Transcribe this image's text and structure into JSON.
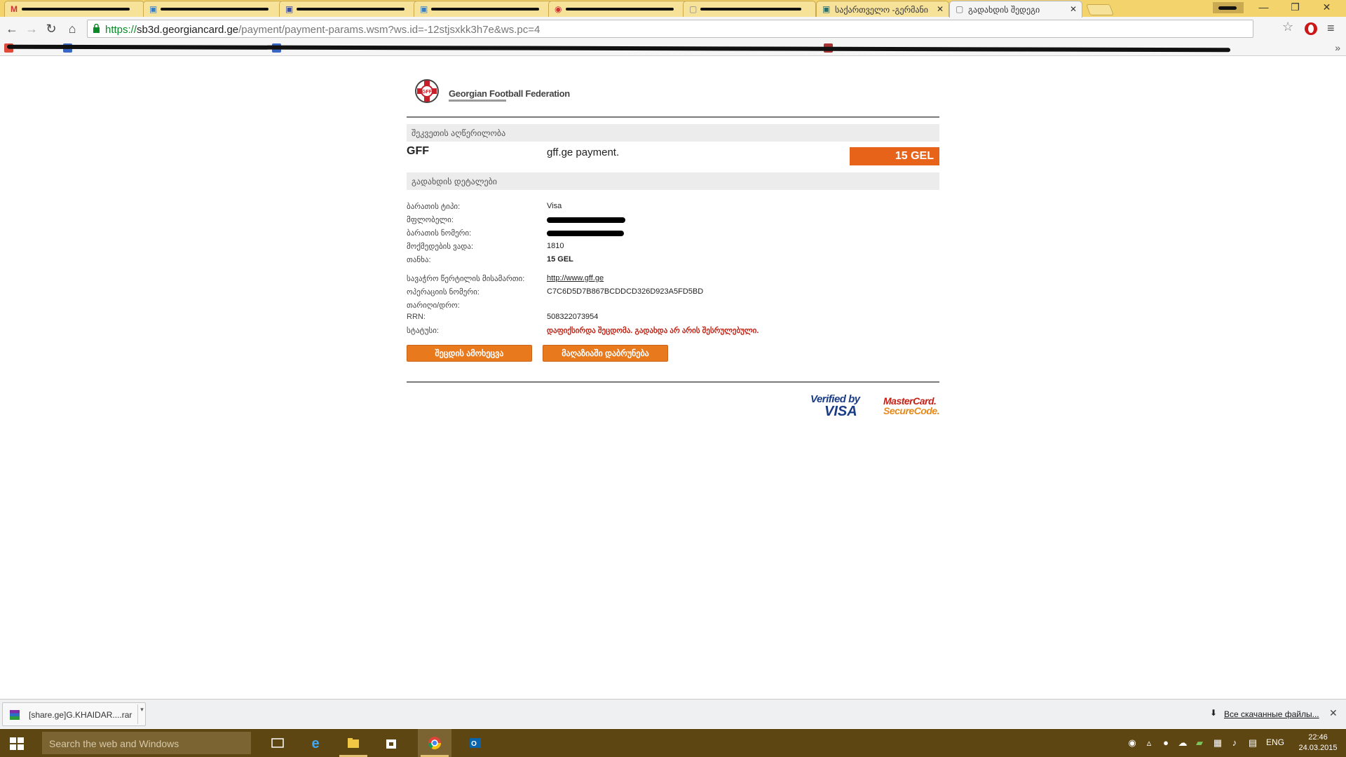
{
  "browser": {
    "tabs": [
      {
        "title": "",
        "favicon": "gmail-icon",
        "redacted": true
      },
      {
        "title": "",
        "favicon": "page-icon",
        "redacted": true
      },
      {
        "title": "",
        "favicon": "page-icon",
        "redacted": true
      },
      {
        "title": "",
        "favicon": "page-icon",
        "redacted": true
      },
      {
        "title": "",
        "favicon": "page-icon",
        "redacted": true
      },
      {
        "title": "",
        "favicon": "page-icon",
        "redacted": true
      },
      {
        "title": "საქართველო -გერმანი",
        "favicon": "page-icon",
        "redacted": false
      },
      {
        "title": "გადახდის შედეგი",
        "favicon": "page-icon",
        "redacted": false,
        "active": true
      }
    ],
    "window_controls": {
      "minimize": "—",
      "restore": "❐",
      "close": "✕"
    },
    "url_proto": "https://",
    "url_host": "sb3d.georgiancard.ge",
    "url_path": "/payment/payment-params.wsm?ws.id=-12stjsxkk3h7e&ws.pc=4"
  },
  "page": {
    "logo_text": "Georgian Football Federation",
    "section_order": "შეკვეთის აღწერილობა",
    "merchant": "GFF",
    "description": "gff.ge payment.",
    "amount_badge": "15 GEL",
    "section_details": "გადახდის დეტალები",
    "details": [
      {
        "label": "ბარათის ტიპი:",
        "value": "Visa"
      },
      {
        "label": "მფლობელი:",
        "value": "",
        "redacted": true
      },
      {
        "label": "ბარათის ნომერი:",
        "value": "",
        "redacted": true
      },
      {
        "label": "მოქმედების ვადა:",
        "value": "1810"
      },
      {
        "label": "თანხა:",
        "value": "15 GEL"
      }
    ],
    "details2": [
      {
        "label": "სავაჭრო წერტილის მისამართი:",
        "value": "http://www.gff.ge"
      },
      {
        "label": "ოპერაციის ნომერი:",
        "value": "C7C6D5D7B867BCDDCD326D923A5FD5BD"
      },
      {
        "label": "თარიღი/დრო:",
        "value": ""
      },
      {
        "label": "RRN:",
        "value": "508322073954"
      },
      {
        "label": "სტატუსი:",
        "value": "დაფიქსირდა შეცდომა. გადახდა არ არის შესრულებული."
      }
    ],
    "button_repeat": "შეცდის ამოხეცვა",
    "button_return": "მაღაზიაში დაბრუნება",
    "badge_vbv_line1": "Verified by",
    "badge_vbv_line2": "VISA",
    "badge_mc_line1": "MasterCard.",
    "badge_mc_line2": "SecureCode."
  },
  "downloads": {
    "file_name": "[share.ge]G.KHAIDAR....rar",
    "show_all": "Все скачанные файлы..."
  },
  "taskbar": {
    "search_placeholder": "Search the web and Windows",
    "lang": "ENG",
    "time": "22:46",
    "date": "24.03.2015"
  },
  "colors": {
    "accent_orange": "#e8631a",
    "error_red": "#c0271a",
    "taskbar": "#5e4613",
    "tabstrip": "#f3d36b"
  }
}
